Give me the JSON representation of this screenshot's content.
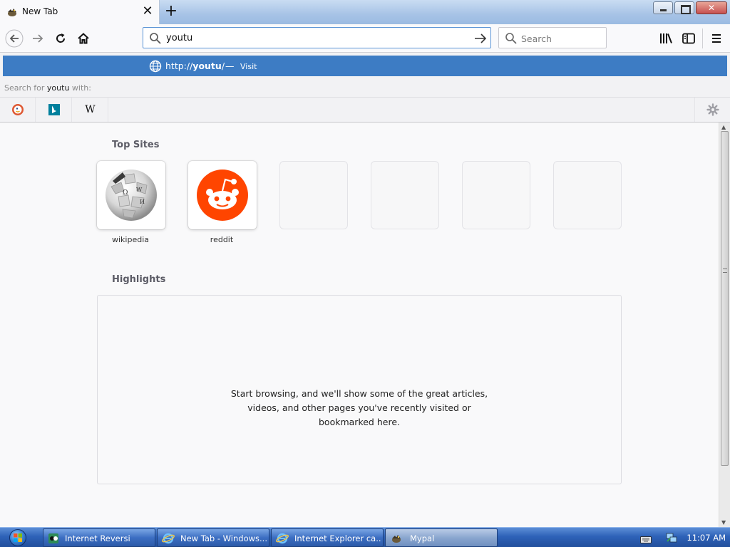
{
  "browser": {
    "tab": {
      "title": "New Tab",
      "close_label": "✕"
    },
    "new_tab_label": "+",
    "url_input": {
      "value": "youtu"
    },
    "search_input": {
      "placeholder": "Search"
    }
  },
  "popup": {
    "suggestion": {
      "url_prefix": "http://",
      "url_bold": "youtu",
      "url_suffix": "/",
      "dash": "—",
      "action": "Visit"
    },
    "search_for": {
      "prefix": "Search for ",
      "query": "youtu",
      "suffix": " with:"
    },
    "engines": [
      "DuckDuckGo",
      "Bing",
      "Wikipedia"
    ],
    "wiki_glyph": "W"
  },
  "page": {
    "top_sites_title": "Top Sites",
    "top_sites": [
      {
        "label": "wikipedia"
      },
      {
        "label": "reddit"
      }
    ],
    "highlights_title": "Highlights",
    "highlights_msg_lines": [
      "Start browsing, and we'll show some of the great articles,",
      "videos, and other pages you've recently visited or",
      "bookmarked here."
    ]
  },
  "taskbar": {
    "tasks": [
      {
        "label": "Internet Reversi"
      },
      {
        "label": "New Tab - Windows..."
      },
      {
        "label": "Internet Explorer ca..."
      },
      {
        "label": "Mypal"
      }
    ],
    "clock": "11:07 AM"
  },
  "colors": {
    "accent": "#3d7cc4",
    "reddit": "#ff4500",
    "taskbar": "#2e62b8"
  }
}
